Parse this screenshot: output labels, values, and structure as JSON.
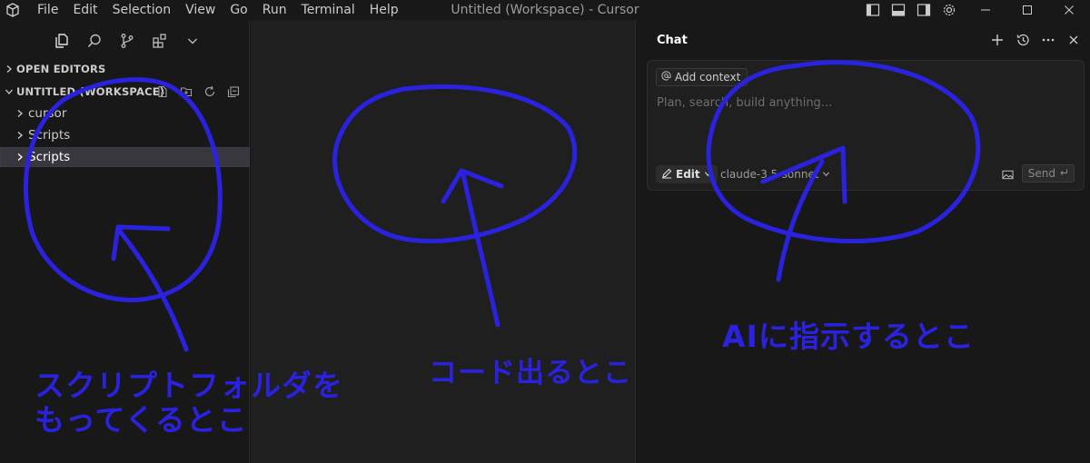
{
  "menubar": {
    "items": [
      "File",
      "Edit",
      "Selection",
      "View",
      "Go",
      "Run",
      "Terminal",
      "Help"
    ]
  },
  "window": {
    "title": "Untitled (Workspace) - Cursor"
  },
  "sidebar": {
    "open_editors": "OPEN EDITORS",
    "workspace": "UNTITLED (WORKSPACE)",
    "items": [
      {
        "label": "cursor"
      },
      {
        "label": "Scripts"
      },
      {
        "label": "Scripts",
        "selected": true
      }
    ]
  },
  "chat": {
    "title": "Chat",
    "add_context": "Add context",
    "placeholder": "Plan, search, build anything...",
    "mode": "Edit",
    "model": "claude-3.5-sonnet",
    "send": "Send"
  },
  "annotations": {
    "sidebar_note_line1": "スクリプトフォルダを",
    "sidebar_note_line2": "もってくるとこ",
    "editor_note": "コード出るとこ",
    "chat_note": "AIに指示するとこ",
    "color": "#2b22e0"
  },
  "colors": {
    "background": "#181818",
    "editor": "#1f1f1f",
    "selection": "#37373d",
    "annotation": "#2b22e0"
  }
}
